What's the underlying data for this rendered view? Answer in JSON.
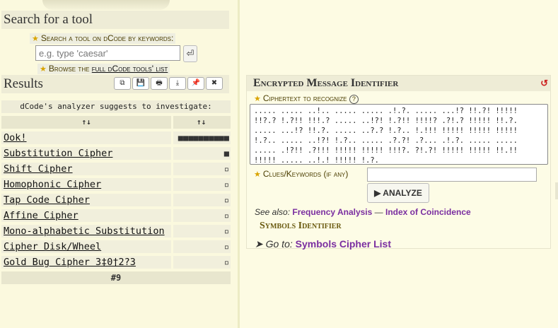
{
  "sidebar": {
    "search_title": "Search for a tool",
    "search_tip": "Search a tool on dCode by keywords:",
    "search_placeholder": "e.g. type 'caesar'",
    "enter_symbol": "⏎",
    "browse_prefix": "Browse the ",
    "browse_link": "full dCode tools' list",
    "results_title": "Results",
    "toolbar": [
      "⧉",
      "💾",
      "🖶",
      "⤓",
      "📌",
      "✖"
    ],
    "analyzer_header": "dCode's analyzer suggests to investigate:",
    "sort_labels": [
      "↑↓",
      "↑↓"
    ],
    "rows": [
      {
        "name": "Ook!",
        "score": "■■■■■■■■■■"
      },
      {
        "name": "Substitution Cipher",
        "score": "■"
      },
      {
        "name": "Shift Cipher",
        "score": "▫"
      },
      {
        "name": "Homophonic Cipher",
        "score": "▫"
      },
      {
        "name": "Tap Code Cipher",
        "score": "▫"
      },
      {
        "name": "Affine Cipher",
        "score": "▫"
      },
      {
        "name": "Mono-alphabetic Substitution",
        "score": "▫"
      },
      {
        "name": "Cipher Disk/Wheel",
        "score": "▫"
      },
      {
        "name": "Gold Bug Cipher 3‡0†2?3",
        "score": "▫"
      }
    ],
    "pager": "#9"
  },
  "panel": {
    "title": "Encrypted Message Identifier",
    "reload": "↺",
    "ciphertext_label": "Ciphertext to recognize",
    "help": "?",
    "ciphertext": "..... ..... ..!.. ..... ..... .!.?. ..... ...!? !!.?! !!!!!\n!!?.? !.?!! !!!.? ..... ..!?! !.?!! !!!!? .?!.? !!!!! !!.?.\n..... ...!? !!.?. ..... ..?.? !.?.. !.!!! !!!!! !!!!! !!!!!\n!.?.. ..... ..!?! !.?.. ..... .?.?! .?... .!.?. ..... .....\n..... .!?!! .?!!! !!!!! !!!!! !!!?. ?!.?! !!!!! !!!!! !!.!!\n!!!!! ..... ..!.! !!!!! !.?.",
    "clues_label": "Clues/Keywords (if any)",
    "analyze": "▶ ANALYZE",
    "see_also_prefix": "See also: ",
    "see_also_links": [
      "Frequency Analysis",
      "Index of Coincidence"
    ],
    "see_also_sep": " — ",
    "symbols_identifier": "Symbols Identifier",
    "goto_prefix": "➤ Go to: ",
    "goto_link": "Symbols Cipher List"
  },
  "colors": {
    "accent_star": "#d9a400",
    "link": "#7a2ea0",
    "reload": "#cc2222"
  }
}
